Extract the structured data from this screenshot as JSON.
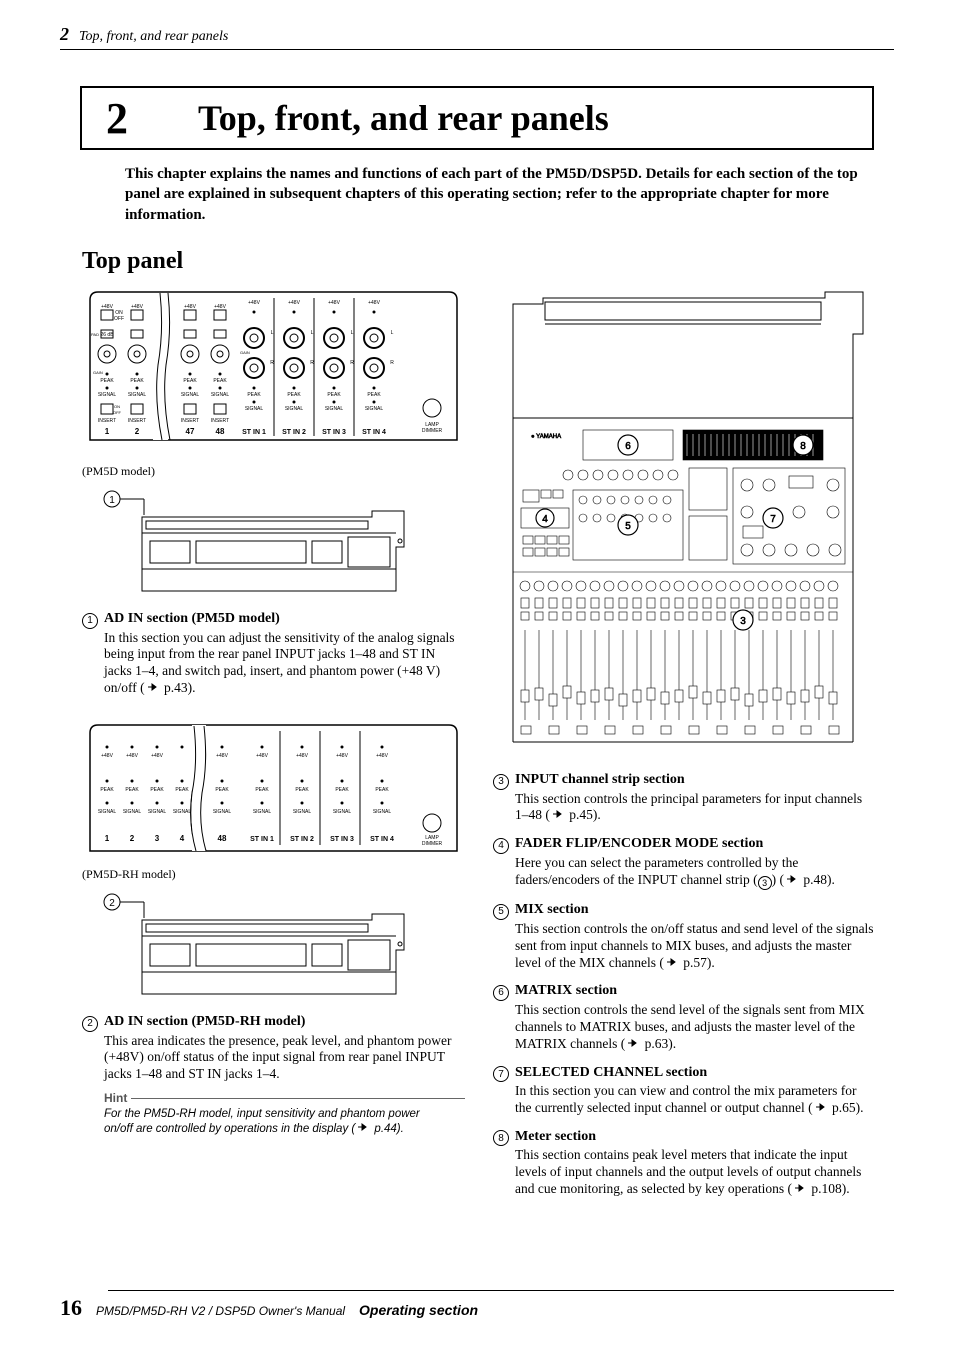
{
  "header": {
    "num": "2",
    "title": "Top, front, and rear panels"
  },
  "chapter": {
    "num": "2",
    "title": "Top, front, and rear panels"
  },
  "intro": "This chapter explains the names and functions of each part of the PM5D/DSP5D. Details for each section of the top panel are explained in subsequent chapters of this operating section; refer to the appropriate chapter for more information.",
  "section": "Top panel",
  "captions": {
    "fig1": "(PM5D model)",
    "fig3": "(PM5D-RH model)"
  },
  "left_items": [
    {
      "num": "1",
      "title": "AD IN section (PM5D model)",
      "body_parts": [
        "In this section you can adjust the sensitivity of the analog signals being input from the rear panel INPUT jacks 1–48 and ST IN jacks 1–4, and switch pad, insert, and phantom power (+48 V) on/off (",
        " p.43)."
      ]
    },
    {
      "num": "2",
      "title": "AD IN section (PM5D-RH model)",
      "body_parts": [
        "This area indicates the presence, peak level, and phantom power (+48V) on/off status of the input signal from rear panel INPUT jacks 1–48 and ST IN jacks 1–4."
      ]
    }
  ],
  "hint": {
    "label": "Hint",
    "body_parts": [
      "For the PM5D-RH model, input sensitivity and phantom power on/off are controlled by operations in the display (",
      " p.44)."
    ]
  },
  "right_items": [
    {
      "num": "3",
      "title": "INPUT channel strip section",
      "body_parts": [
        "This section controls the principal parameters for input channels 1–48 (",
        " p.45)."
      ]
    },
    {
      "num": "4",
      "title": "FADER FLIP/ENCODER MODE section",
      "body_parts": [
        "Here you can select the parameters controlled by the faders/encoders of the INPUT channel strip (",
        "CIRC3",
        ") (",
        " p.48)."
      ]
    },
    {
      "num": "5",
      "title": "MIX section",
      "body_parts": [
        "This section controls the on/off status and send level of the signals sent from input channels to MIX buses, and adjusts the master level of the MIX channels (",
        " p.57)."
      ]
    },
    {
      "num": "6",
      "title": "MATRIX section",
      "body_parts": [
        "This section controls the send level of the signals sent from MIX channels to MATRIX buses, and adjusts the master level of the MATRIX channels (",
        " p.63)."
      ]
    },
    {
      "num": "7",
      "title": "SELECTED CHANNEL section",
      "body_parts": [
        "In this section you can view and control the mix parameters for the currently selected input channel or output channel (",
        " p.65)."
      ]
    },
    {
      "num": "8",
      "title": "Meter section",
      "body_parts": [
        "This section contains peak level meters that indicate the input levels of input channels and the output levels of output channels and cue monitoring, as selected by key operations (",
        " p.108)."
      ]
    }
  ],
  "panel_labels": {
    "pm5d_channels": [
      "1",
      "2",
      "47",
      "48"
    ],
    "stin": [
      "ST IN 1",
      "ST IN 2",
      "ST IN 3",
      "ST IN 4"
    ],
    "v48": "+48V",
    "on": "ON",
    "off": "OFF",
    "peak": "PEAK",
    "signal": "SIGNAL",
    "insert": "INSERT",
    "pad": "PAD",
    "gain": "GAIN",
    "lamp": "LAMP DIMMER",
    "yamaha": "YAMAHA",
    "rh_channels": [
      "1",
      "2",
      "3",
      "4",
      "48"
    ]
  },
  "footer": {
    "page": "16",
    "manual": "PM5D/PM5D-RH V2 / DSP5D Owner's Manual",
    "section": "Operating section"
  }
}
